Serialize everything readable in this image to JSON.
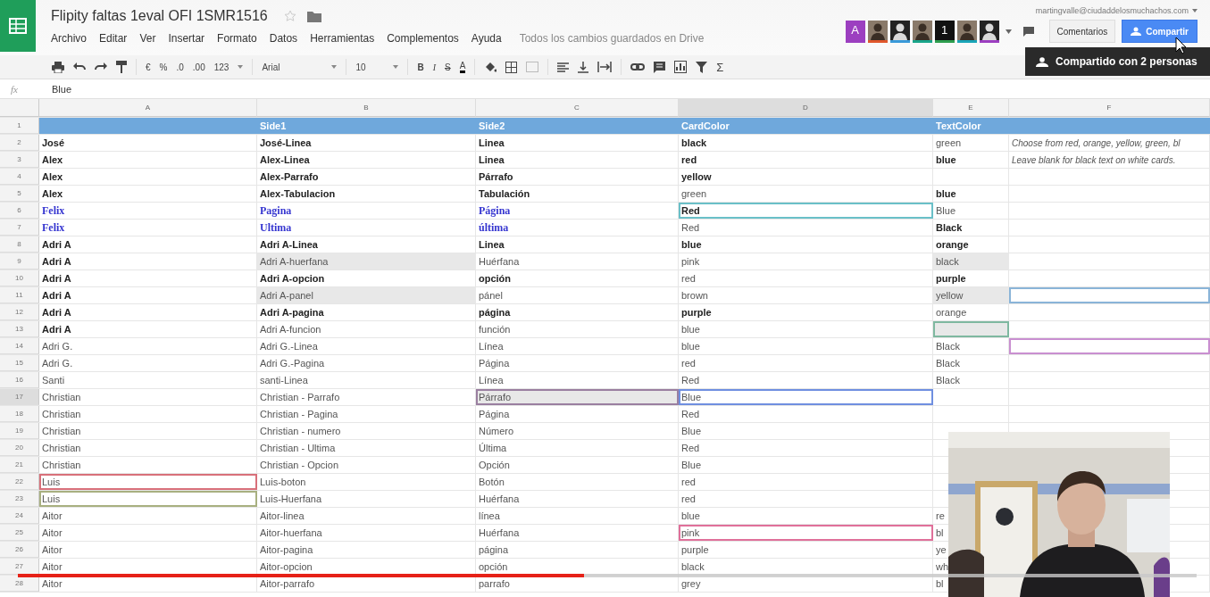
{
  "document": {
    "title": "Flipity faltas 1eval OFI 1SMR1516",
    "save_status": "Todos los cambios guardados en Drive"
  },
  "menu": [
    "Archivo",
    "Editar",
    "Ver",
    "Insertar",
    "Formato",
    "Datos",
    "Herramientas",
    "Complementos",
    "Ayuda"
  ],
  "account": {
    "email": "martingvalle@ciudaddelosmuchachos.com"
  },
  "collaborators": [
    {
      "label": "A",
      "color": "#9c3fc0"
    },
    {
      "color": "#e0572c"
    },
    {
      "color": "#3a9ad9"
    },
    {
      "color": "#1aa58a"
    },
    {
      "label": "1",
      "color": "#2e9e4f"
    },
    {
      "color": "#1aa5b8"
    },
    {
      "color": "#9c3fc0"
    }
  ],
  "buttons": {
    "comments": "Comentarios",
    "share": "Compartir"
  },
  "tooltip": "Compartido con 2 personas",
  "toolbar": {
    "currency": "€",
    "percent": "%",
    "decrease_decimals": ".0",
    "increase_decimals": ".00",
    "number_format": "123",
    "font": "Arial",
    "font_size": "10",
    "bold": "B",
    "italic": "I",
    "strikethrough": "S",
    "text_color": "A",
    "functions": "Σ"
  },
  "formula_bar": {
    "label": "fx",
    "value": "Blue"
  },
  "grid": {
    "columns": [
      {
        "label": "A",
        "selected": false
      },
      {
        "label": "B",
        "selected": false
      },
      {
        "label": "C",
        "selected": false
      },
      {
        "label": "D",
        "selected": true
      },
      {
        "label": "E",
        "selected": false
      },
      {
        "label": "F",
        "selected": false
      }
    ],
    "rows": [
      {
        "number": "1",
        "selected": false,
        "kind": "header",
        "cells": [
          null,
          {
            "text": "Side1",
            "bold": true
          },
          {
            "text": "Side2",
            "bold": true
          },
          {
            "text": "CardColor",
            "bold": true
          },
          {
            "text": "TextColor",
            "bold": true
          },
          null
        ]
      },
      {
        "number": "2",
        "selected": false,
        "kind": "plain",
        "cells": [
          {
            "text": "José",
            "bold": true
          },
          {
            "text": "José-Linea",
            "bold": true
          },
          {
            "text": "Linea",
            "bold": true
          },
          {
            "text": "black",
            "bold": true
          },
          {
            "text": "green",
            "bold": false
          },
          {
            "text": "Choose from red, orange, yellow, green, bl",
            "bold": false,
            "italic": true
          }
        ]
      },
      {
        "number": "3",
        "selected": false,
        "kind": "plain",
        "cells": [
          {
            "text": "Alex",
            "bold": true
          },
          {
            "text": "Alex-Linea",
            "bold": true
          },
          {
            "text": "Linea",
            "bold": true
          },
          {
            "text": "red",
            "bold": true
          },
          {
            "text": "blue",
            "bold": true
          },
          {
            "text": "Leave blank for black text on white cards.",
            "bold": false,
            "italic": true
          }
        ]
      },
      {
        "number": "4",
        "selected": false,
        "kind": "plain",
        "cells": [
          {
            "text": "Alex",
            "bold": true
          },
          {
            "text": "Alex-Parrafo",
            "bold": true
          },
          {
            "text": "Párrafo",
            "bold": true
          },
          {
            "text": "yellow",
            "bold": true
          },
          null,
          null
        ]
      },
      {
        "number": "5",
        "selected": false,
        "kind": "plain",
        "cells": [
          {
            "text": "Alex",
            "bold": true
          },
          {
            "text": "Alex-Tabulacion",
            "bold": true
          },
          {
            "text": "Tabulación",
            "bold": true
          },
          {
            "text": "green",
            "bold": false
          },
          {
            "text": "blue",
            "bold": true
          },
          null
        ]
      },
      {
        "number": "6",
        "selected": false,
        "kind": "blue",
        "cells": [
          {
            "text": "Felix",
            "bold": true
          },
          {
            "text": "Pagina",
            "bold": true
          },
          {
            "text": "Página",
            "bold": true
          },
          {
            "text": "Red",
            "bold": true,
            "color": "#6ac0c8"
          },
          {
            "text": "Blue",
            "bold": false
          },
          null
        ]
      },
      {
        "number": "7",
        "selected": false,
        "kind": "blue",
        "cells": [
          {
            "text": "Felix",
            "bold": true
          },
          {
            "text": "Ultima",
            "bold": true
          },
          {
            "text": "última",
            "bold": true
          },
          {
            "text": "Red",
            "bold": false
          },
          {
            "text": "Black",
            "bold": true
          },
          null
        ]
      },
      {
        "number": "8",
        "selected": false,
        "kind": "plain",
        "cells": [
          {
            "text": "Adri A",
            "bold": true
          },
          {
            "text": "Adri A-Linea",
            "bold": true
          },
          {
            "text": "Linea",
            "bold": true
          },
          {
            "text": "blue",
            "bold": true
          },
          {
            "text": "orange",
            "bold": true
          },
          null
        ]
      },
      {
        "number": "9",
        "selected": false,
        "kind": "plain",
        "cells": [
          {
            "text": "Adri A",
            "bold": true
          },
          {
            "text": "Adri A-huerfana",
            "bold": false,
            "shaded": true
          },
          {
            "text": "Huérfana",
            "bold": false
          },
          {
            "text": "pink",
            "bold": false
          },
          {
            "text": "black",
            "bold": false,
            "shaded": true
          },
          null
        ]
      },
      {
        "number": "10",
        "selected": false,
        "kind": "plain",
        "cells": [
          {
            "text": "Adri A",
            "bold": true
          },
          {
            "text": "Adri A-opcion",
            "bold": true
          },
          {
            "text": "opción",
            "bold": true
          },
          {
            "text": "red",
            "bold": false
          },
          {
            "text": "purple",
            "bold": true
          },
          null
        ]
      },
      {
        "number": "11",
        "selected": false,
        "kind": "plain",
        "cells": [
          {
            "text": "Adri A",
            "bold": true
          },
          {
            "text": "Adri A-panel",
            "bold": false,
            "shaded": true
          },
          {
            "text": "pánel",
            "bold": false
          },
          {
            "text": "brown",
            "bold": false
          },
          {
            "text": "yellow",
            "bold": false,
            "shaded": true
          },
          {
            "color": "#8ab4d8"
          }
        ]
      },
      {
        "number": "12",
        "selected": false,
        "kind": "plain",
        "cells": [
          {
            "text": "Adri A",
            "bold": true
          },
          {
            "text": "Adri A-pagina",
            "bold": true
          },
          {
            "text": "página",
            "bold": true
          },
          {
            "text": "purple",
            "bold": true
          },
          {
            "text": "orange",
            "bold": false
          },
          null
        ]
      },
      {
        "number": "13",
        "selected": false,
        "kind": "plain",
        "cells": [
          {
            "text": "Adri A",
            "bold": true
          },
          {
            "text": "Adri A-funcion",
            "bold": false
          },
          {
            "text": "función",
            "bold": false
          },
          {
            "text": "blue",
            "bold": false
          },
          {
            "shaded": true,
            "color": "#7fb8a0"
          },
          null
        ]
      },
      {
        "number": "14",
        "selected": false,
        "kind": "plain",
        "cells": [
          {
            "text": "Adri G.",
            "bold": false
          },
          {
            "text": "Adri G.-Linea",
            "bold": false
          },
          {
            "text": "Línea",
            "bold": false
          },
          {
            "text": "blue",
            "bold": false
          },
          {
            "text": "Black",
            "bold": false
          },
          {
            "color": "#c98fd0"
          }
        ]
      },
      {
        "number": "15",
        "selected": false,
        "kind": "plain",
        "cells": [
          {
            "text": "Adri G.",
            "bold": false
          },
          {
            "text": "Adri G.-Pagina",
            "bold": false
          },
          {
            "text": "Página",
            "bold": false
          },
          {
            "text": "red",
            "bold": false
          },
          {
            "text": "Black",
            "bold": false
          },
          null
        ]
      },
      {
        "number": "16",
        "selected": false,
        "kind": "plain",
        "cells": [
          {
            "text": "Santi",
            "bold": false
          },
          {
            "text": "santi-Linea",
            "bold": false
          },
          {
            "text": "Línea",
            "bold": false
          },
          {
            "text": "Red",
            "bold": false
          },
          {
            "text": "Black",
            "bold": false
          },
          null
        ]
      },
      {
        "number": "17",
        "selected": true,
        "kind": "plain",
        "cells": [
          {
            "text": "Christian",
            "bold": false
          },
          {
            "text": "Christian - Parrafo",
            "bold": false
          },
          {
            "text": "Párrafo",
            "bold": false,
            "shaded": true,
            "color": "#9a7fa0"
          },
          {
            "text": "Blue",
            "bold": false,
            "color": "#6f8fe0"
          },
          null,
          null
        ]
      },
      {
        "number": "18",
        "selected": false,
        "kind": "plain",
        "cells": [
          {
            "text": "Christian",
            "bold": false
          },
          {
            "text": "Christian - Pagina",
            "bold": false
          },
          {
            "text": "Página",
            "bold": false
          },
          {
            "text": "Red",
            "bold": false
          },
          null,
          null
        ]
      },
      {
        "number": "19",
        "selected": false,
        "kind": "plain",
        "cells": [
          {
            "text": "Christian",
            "bold": false
          },
          {
            "text": "Christian - numero",
            "bold": false
          },
          {
            "text": "Número",
            "bold": false
          },
          {
            "text": "Blue",
            "bold": false
          },
          null,
          null
        ]
      },
      {
        "number": "20",
        "selected": false,
        "kind": "plain",
        "cells": [
          {
            "text": "Christian",
            "bold": false
          },
          {
            "text": "Christian - Ultima",
            "bold": false
          },
          {
            "text": "Última",
            "bold": false
          },
          {
            "text": "Red",
            "bold": false
          },
          null,
          null
        ]
      },
      {
        "number": "21",
        "selected": false,
        "kind": "plain",
        "cells": [
          {
            "text": "Christian",
            "bold": false
          },
          {
            "text": "Christian - Opcion",
            "bold": false
          },
          {
            "text": "Opción",
            "bold": false
          },
          {
            "text": "Blue",
            "bold": false
          },
          null,
          null
        ]
      },
      {
        "number": "22",
        "selected": false,
        "kind": "plain",
        "cells": [
          {
            "text": "Luis",
            "bold": false,
            "color": "#d8707a"
          },
          {
            "text": "Luis-boton",
            "bold": false
          },
          {
            "text": "Botón",
            "bold": false
          },
          {
            "text": "red",
            "bold": false
          },
          null,
          null
        ]
      },
      {
        "number": "23",
        "selected": false,
        "kind": "plain",
        "cells": [
          {
            "text": "Luis",
            "bold": false,
            "color": "#a8b080"
          },
          {
            "text": "Luis-Huerfana",
            "bold": false
          },
          {
            "text": "Huérfana",
            "bold": false
          },
          {
            "text": "red",
            "bold": false
          },
          null,
          null
        ]
      },
      {
        "number": "24",
        "selected": false,
        "kind": "plain",
        "cells": [
          {
            "text": "Aitor",
            "bold": false
          },
          {
            "text": "Aitor-linea",
            "bold": false
          },
          {
            "text": "línea",
            "bold": false
          },
          {
            "text": "blue",
            "bold": false
          },
          {
            "text": "re",
            "bold": false
          },
          null
        ]
      },
      {
        "number": "25",
        "selected": false,
        "kind": "plain",
        "cells": [
          {
            "text": "Aitor",
            "bold": false
          },
          {
            "text": "Aitor-huerfana",
            "bold": false
          },
          {
            "text": "Huérfana",
            "bold": false
          },
          {
            "text": "pink",
            "bold": false,
            "color": "#e0709a"
          },
          {
            "text": "bl",
            "bold": false
          },
          null
        ]
      },
      {
        "number": "26",
        "selected": false,
        "kind": "plain",
        "cells": [
          {
            "text": "Aitor",
            "bold": false
          },
          {
            "text": "Aitor-pagina",
            "bold": false
          },
          {
            "text": "página",
            "bold": false
          },
          {
            "text": "purple",
            "bold": false
          },
          {
            "text": "ye",
            "bold": false
          },
          null
        ]
      },
      {
        "number": "27",
        "selected": false,
        "kind": "plain",
        "cells": [
          {
            "text": "Aitor",
            "bold": false
          },
          {
            "text": "Aitor-opcion",
            "bold": false
          },
          {
            "text": "opción",
            "bold": false
          },
          {
            "text": "black",
            "bold": false
          },
          {
            "text": "wh",
            "bold": false
          },
          null
        ]
      },
      {
        "number": "28",
        "selected": false,
        "kind": "plain",
        "cells": [
          {
            "text": "Aitor",
            "bold": false
          },
          {
            "text": "Aitor-parrafo",
            "bold": false
          },
          {
            "text": "parrafo",
            "bold": false
          },
          {
            "text": "grey",
            "bold": false
          },
          {
            "text": "bl",
            "bold": false
          },
          null
        ]
      }
    ]
  },
  "video": {
    "progress": {
      "level": 0.48
    }
  }
}
